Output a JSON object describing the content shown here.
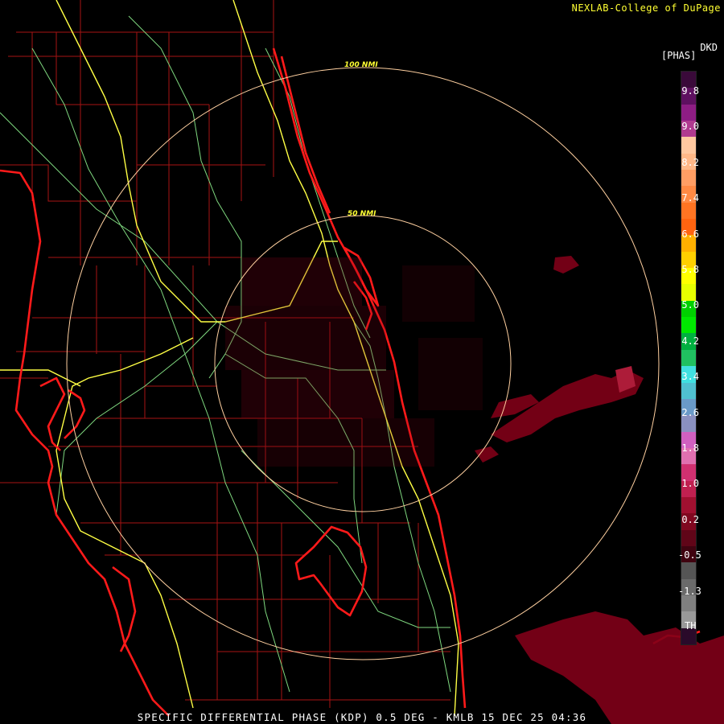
{
  "credit": "NEXLAB-College of DuPage",
  "product_code": "DKD",
  "units": "[PHAS]",
  "range_rings": [
    "100 NMI",
    "50 NMI"
  ],
  "footer": "SPECIFIC DIFFERENTIAL PHASE (KDP) 0.5 DEG - KMLB 15 DEC 25 04:36",
  "scale": {
    "labels": [
      "9.8",
      "9.0",
      "8.2",
      "7.4",
      "6.6",
      "5.8",
      "5.0",
      "4.2",
      "3.4",
      "2.6",
      "1.8",
      "1.0",
      "0.2",
      "-0.5",
      "-1.3"
    ],
    "th_label": "TH",
    "colors": [
      "#3a0a3a",
      "#5e1060",
      "#8e1d84",
      "#b03a8f",
      "#ffc8a0",
      "#ffb888",
      "#ff9e64",
      "#ff8a44",
      "#ff7422",
      "#ff6410",
      "#ffb000",
      "#ffd000",
      "#ffff00",
      "#e6ff00",
      "#00d000",
      "#00e800",
      "#00b040",
      "#20c060",
      "#40e0e0",
      "#50c0d0",
      "#6a9ac8",
      "#8a90c0",
      "#d060c0",
      "#e070b0",
      "#d03070",
      "#c02050",
      "#a01030",
      "#800820",
      "#600518",
      "#400310",
      "#555555",
      "#6a6a6a",
      "#808080",
      "#999999",
      "#2a0a2a"
    ]
  },
  "colors": {
    "coast": "#ff1a1a",
    "county": "#c01818",
    "highway": "#ffff44",
    "road": "#88e088",
    "ring": "#ffd0a0",
    "echo": "#800018"
  }
}
